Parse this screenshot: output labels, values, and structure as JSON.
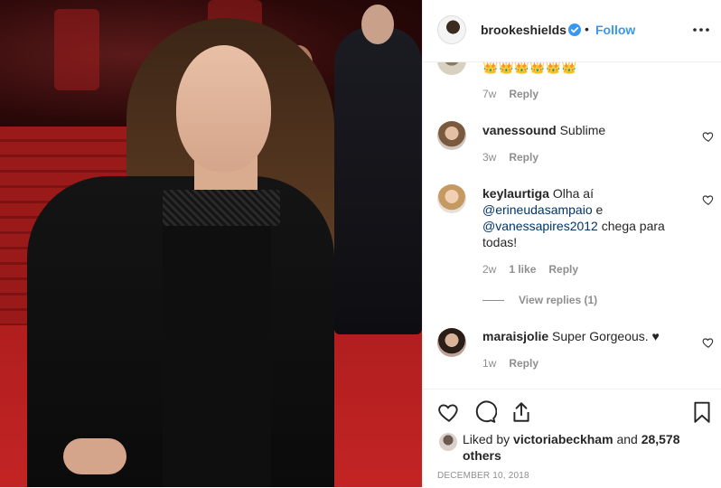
{
  "post": {
    "username": "brookeshields",
    "follow_label": "Follow",
    "separator": "•"
  },
  "comments": [
    {
      "emojis": [
        "👑",
        "👑",
        "👑",
        "👑",
        "👑",
        "👑"
      ],
      "time": "7w",
      "reply_label": "Reply"
    },
    {
      "username": "vanessound",
      "text": "Sublime",
      "time": "3w",
      "reply_label": "Reply"
    },
    {
      "username": "keylaurtiga",
      "text_part1": "Olha aí",
      "mention1": "@erineudasampaio",
      "text_part2": "e",
      "mention2": "@vanessapires2012",
      "text_part3": "chega para todas!",
      "time": "2w",
      "likes": "1 like",
      "reply_label": "Reply",
      "view_replies": "View replies (1)"
    },
    {
      "username": "maraisjolie",
      "text": "Super Gorgeous. ♥",
      "time": "1w",
      "reply_label": "Reply"
    }
  ],
  "likes": {
    "prefix": "Liked by",
    "user": "victoriabeckham",
    "middle": "and",
    "count": "28,578 others"
  },
  "date": "DECEMBER 10, 2018",
  "colors": {
    "accent": "#3897f0",
    "mention": "#003569",
    "muted": "#8e8e8e",
    "text": "#262626"
  }
}
